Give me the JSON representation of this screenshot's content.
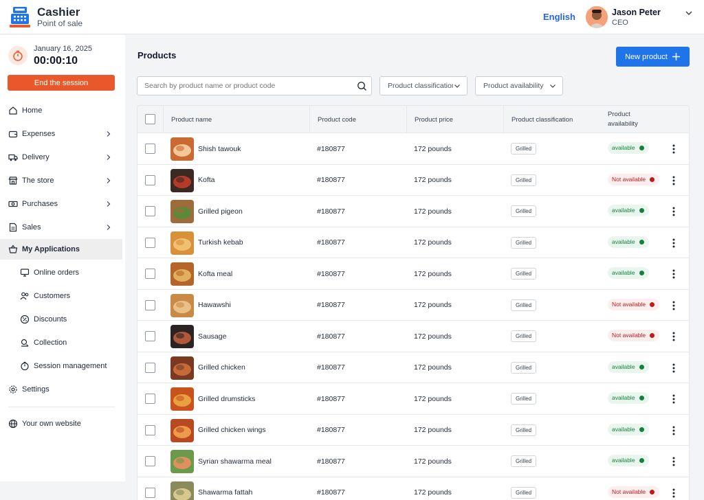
{
  "brand": {
    "title": "Cashier",
    "subtitle": "Point of sale"
  },
  "header": {
    "language": "English",
    "user_name": "Jason Peter",
    "user_role": "CEO"
  },
  "session": {
    "date": "January 16, 2025",
    "elapsed": "00:00:10",
    "end_label": "End the session"
  },
  "sidebar": {
    "items": [
      {
        "label": "Home",
        "icon": "home-icon"
      },
      {
        "label": "Expenses",
        "icon": "wallet-icon"
      },
      {
        "label": "Delivery",
        "icon": "truck-icon"
      },
      {
        "label": "The store",
        "icon": "store-icon"
      },
      {
        "label": "Purchases",
        "icon": "cash-icon"
      },
      {
        "label": "Sales",
        "icon": "sales-icon"
      },
      {
        "label": "My Applications",
        "icon": "basket-icon"
      }
    ],
    "sub_items": [
      {
        "label": "Online orders",
        "icon": "monitor-icon"
      },
      {
        "label": "Customers",
        "icon": "users-icon"
      },
      {
        "label": "Discounts",
        "icon": "discount-icon"
      },
      {
        "label": "Collection",
        "icon": "collection-icon"
      },
      {
        "label": "Session management",
        "icon": "clock-icon"
      }
    ],
    "settings": "Settings",
    "website": "Your own website"
  },
  "main": {
    "title": "Products",
    "new_button": "New product",
    "search_placeholder": "Search by product name or product code",
    "filter_classification": "Product classification",
    "filter_availability": "Product availability"
  },
  "table": {
    "columns": [
      "Product name",
      "Product code",
      "Product price",
      "Product classification",
      "Product",
      "availability"
    ],
    "rows": [
      {
        "name": "Shish tawouk",
        "code": "#180877",
        "price": "172 pounds",
        "classification": "Grilled",
        "availability": "available",
        "available": true
      },
      {
        "name": "Kofta",
        "code": "#180877",
        "price": "172 pounds",
        "classification": "Grilled",
        "availability": "Not available",
        "available": false
      },
      {
        "name": "Grilled pigeon",
        "code": "#180877",
        "price": "172 pounds",
        "classification": "Grilled",
        "availability": "available",
        "available": true
      },
      {
        "name": "Turkish kebab",
        "code": "#180877",
        "price": "172 pounds",
        "classification": "Grilled",
        "availability": "available",
        "available": true
      },
      {
        "name": "Kofta meal",
        "code": "#180877",
        "price": "172 pounds",
        "classification": "Grilled",
        "availability": "available",
        "available": true
      },
      {
        "name": "Hawawshi",
        "code": "#180877",
        "price": "172 pounds",
        "classification": "Grilled",
        "availability": "Not available",
        "available": false
      },
      {
        "name": "Sausage",
        "code": "#180877",
        "price": "172 pounds",
        "classification": "Grilled",
        "availability": "Not available",
        "available": false
      },
      {
        "name": "Grilled chicken",
        "code": "#180877",
        "price": "172 pounds",
        "classification": "Grilled",
        "availability": "available",
        "available": true
      },
      {
        "name": "Grilled drumsticks",
        "code": "#180877",
        "price": "172 pounds",
        "classification": "Grilled",
        "availability": "available",
        "available": true
      },
      {
        "name": "Grilled chicken wings",
        "code": "#180877",
        "price": "172 pounds",
        "classification": "Grilled",
        "availability": "available",
        "available": true
      },
      {
        "name": "Syrian shawarma meal",
        "code": "#180877",
        "price": "172 pounds",
        "classification": "Grilled",
        "availability": "available",
        "available": true
      },
      {
        "name": "Shawarma fattah",
        "code": "#180877",
        "price": "172 pounds",
        "classification": "Grilled",
        "availability": "Not available",
        "available": false
      }
    ]
  },
  "colors": {
    "accent": "#1e74e8",
    "end_session": "#e8582a",
    "available": "#15803d",
    "not_available": "#b91c1c"
  }
}
